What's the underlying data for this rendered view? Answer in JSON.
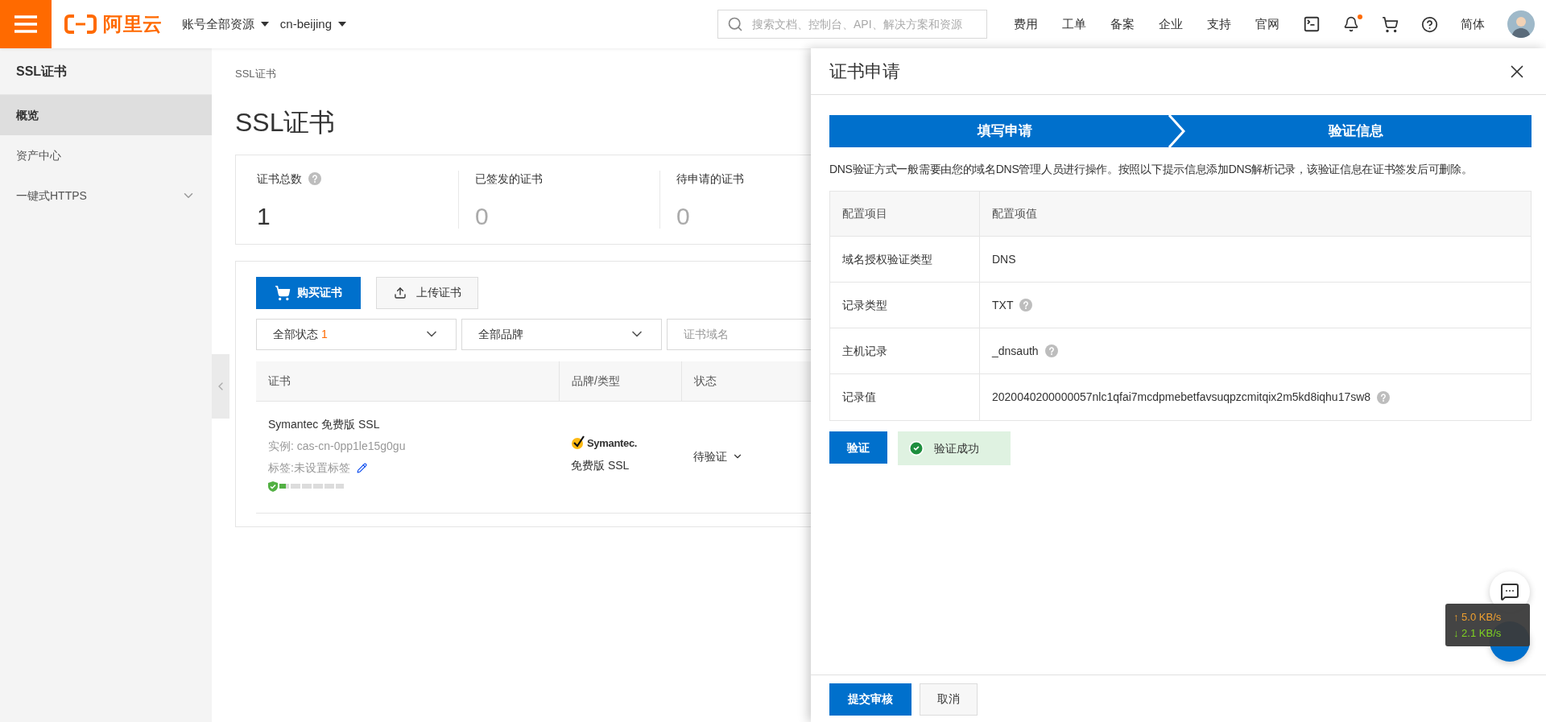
{
  "topbar": {
    "logo_text": "阿里云",
    "account_menu": "账号全部资源",
    "region": "cn-beijing",
    "search": {
      "placeholder": "搜索文档、控制台、API、解决方案和资源"
    },
    "nav": [
      "费用",
      "工单",
      "备案",
      "企业",
      "支持",
      "官网"
    ],
    "notification_dot": true,
    "language": "简体"
  },
  "sidebar": {
    "title": "SSL证书",
    "items": [
      {
        "label": "概览",
        "selected": true,
        "has_submenu": false
      },
      {
        "label": "资产中心",
        "selected": false,
        "has_submenu": false
      },
      {
        "label": "一键式HTTPS",
        "selected": false,
        "has_submenu": true
      }
    ]
  },
  "breadcrumb": "SSL证书",
  "page_title": "SSL证书",
  "stats": [
    {
      "label": "证书总数",
      "value": "1",
      "help": true,
      "muted": false
    },
    {
      "label": "已签发的证书",
      "value": "0",
      "help": false,
      "muted": true
    },
    {
      "label": "待申请的证书",
      "value": "0",
      "help": false,
      "muted": true
    }
  ],
  "toolbar": [
    {
      "label": "购买证书",
      "kind": "primary"
    },
    {
      "label": "上传证书",
      "kind": "secondary"
    }
  ],
  "filters": [
    {
      "kind": "select",
      "value": "全部状态",
      "count": "1"
    },
    {
      "kind": "select",
      "value": "全部品牌"
    },
    {
      "kind": "input",
      "placeholder": "证书域名"
    }
  ],
  "table": {
    "columns": [
      "证书",
      "品牌/类型",
      "状态"
    ],
    "rows": [
      {
        "name": "Symantec 免费版 SSL",
        "instance": "实例: cas-cn-0pp1le15g0gu",
        "tags": "标签:未设置标签",
        "level": 0.1,
        "brand_logo": "Symantec.",
        "type": "免费版 SSL",
        "status": "待验证"
      }
    ]
  },
  "drawer": {
    "title": "证书申请",
    "steps": [
      {
        "label": "填写申请",
        "completed": true
      },
      {
        "label": "验证信息",
        "completed": true
      }
    ],
    "description": "DNS验证方式一般需要由您的域名DNS管理人员进行操作。按照以下提示信息添加DNS解析记录，该验证信息在证书签发后可删除。",
    "config_table": {
      "columns": [
        "配置项目",
        "配置项值"
      ],
      "rows": [
        {
          "item": "域名授权验证类型",
          "value": "DNS",
          "help": false
        },
        {
          "item": "记录类型",
          "value": "TXT",
          "help": true
        },
        {
          "item": "主机记录",
          "value": "_dnsauth",
          "help": true
        },
        {
          "item": "记录值",
          "value": "2020040200000057nlc1qfai7mcdpmebetfavsuqpzcmitqix2m5kd8iqhu17sw8",
          "help": true
        }
      ]
    },
    "verify_button": "验证",
    "result": {
      "text": "验证成功",
      "success": true
    },
    "footer_buttons": [
      {
        "label": "提交审核",
        "kind": "primary"
      },
      {
        "label": "取消",
        "kind": "secondary"
      }
    ]
  },
  "network_speed": {
    "upload": "↑ 5.0 KB/s",
    "download": "↓ 2.1 KB/s"
  }
}
